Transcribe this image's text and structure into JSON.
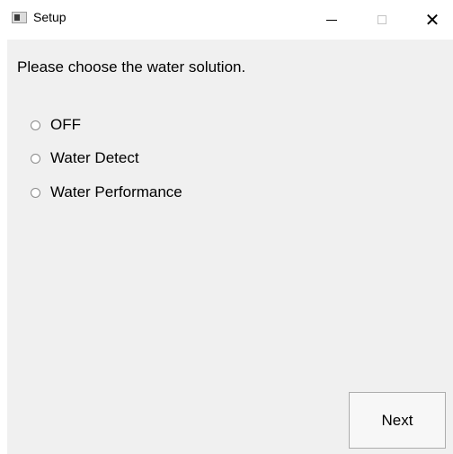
{
  "window": {
    "title": "Setup",
    "controls": {
      "minimize_icon": "minimize-icon",
      "maximize_icon": "maximize-icon",
      "close_icon": "close-icon",
      "close_glyph": "✕"
    }
  },
  "main": {
    "prompt": "Please choose the water solution.",
    "options": [
      {
        "label": "OFF",
        "selected": false
      },
      {
        "label": "Water Detect",
        "selected": false
      },
      {
        "label": "Water Performance",
        "selected": false
      }
    ],
    "next_label": "Next"
  },
  "colors": {
    "client_background": "#f0f0f0",
    "titlebar_background": "#ffffff",
    "button_border": "#adadad"
  }
}
